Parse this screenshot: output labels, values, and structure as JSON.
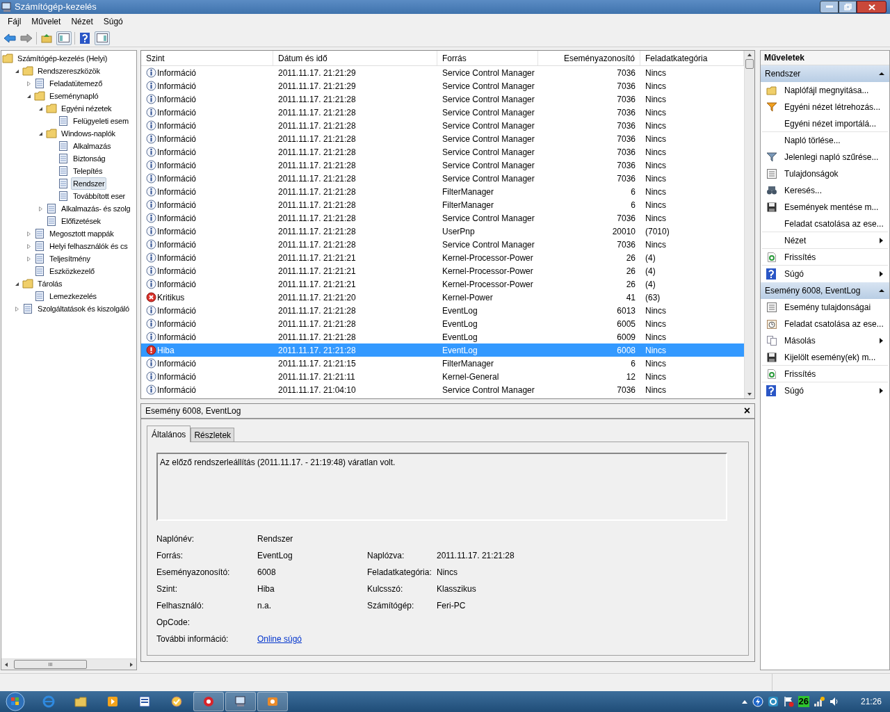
{
  "window": {
    "title": "Számítógép-kezelés"
  },
  "menu": [
    "Fájl",
    "Művelet",
    "Nézet",
    "Súgó"
  ],
  "tree": [
    {
      "label": "Számítógép-kezelés (Helyi)",
      "selected": false,
      "children": [
        {
          "label": "Rendszereszközök",
          "selected": false,
          "expanded": true,
          "children": [
            {
              "label": "Feladatütemező",
              "selected": false,
              "expanded": false
            },
            {
              "label": "Eseménynapló",
              "selected": false,
              "expanded": true,
              "children": [
                {
                  "label": "Egyéni nézetek",
                  "selected": false,
                  "expanded": true,
                  "children": [
                    {
                      "label": "Felügyeleti esem",
                      "selected": false
                    }
                  ]
                },
                {
                  "label": "Windows-naplók",
                  "selected": false,
                  "expanded": true,
                  "children": [
                    {
                      "label": "Alkalmazás",
                      "selected": false
                    },
                    {
                      "label": "Biztonság",
                      "selected": false
                    },
                    {
                      "label": "Telepítés",
                      "selected": false
                    },
                    {
                      "label": "Rendszer",
                      "selected": true
                    },
                    {
                      "label": "Továbbított eser",
                      "selected": false
                    }
                  ]
                },
                {
                  "label": "Alkalmazás- és szolg",
                  "selected": false,
                  "expanded": false
                },
                {
                  "label": "Előfizetések",
                  "selected": false
                }
              ]
            },
            {
              "label": "Megosztott mappák",
              "selected": false,
              "expanded": false
            },
            {
              "label": "Helyi felhasználók és cs",
              "selected": false,
              "expanded": false
            },
            {
              "label": "Teljesítmény",
              "selected": false,
              "expanded": false
            },
            {
              "label": "Eszközkezelő",
              "selected": false
            }
          ]
        },
        {
          "label": "Tárolás",
          "selected": false,
          "expanded": true,
          "children": [
            {
              "label": "Lemezkezelés",
              "selected": false
            }
          ]
        },
        {
          "label": "Szolgáltatások és kiszolgáló",
          "selected": false,
          "expanded": false
        }
      ]
    }
  ],
  "table": {
    "columns": [
      "Szint",
      "Dátum és idő",
      "Forrás",
      "Eseményazonosító",
      "Feladatkategória"
    ],
    "rows": [
      {
        "kind": "info",
        "level_text": "Információ",
        "date": "2011.11.17. 21:21:29",
        "source": "Service Control Manager",
        "id": "7036",
        "category": "Nincs",
        "selected": false
      },
      {
        "kind": "info",
        "level_text": "Információ",
        "date": "2011.11.17. 21:21:29",
        "source": "Service Control Manager",
        "id": "7036",
        "category": "Nincs",
        "selected": false
      },
      {
        "kind": "info",
        "level_text": "Információ",
        "date": "2011.11.17. 21:21:28",
        "source": "Service Control Manager",
        "id": "7036",
        "category": "Nincs",
        "selected": false
      },
      {
        "kind": "info",
        "level_text": "Információ",
        "date": "2011.11.17. 21:21:28",
        "source": "Service Control Manager",
        "id": "7036",
        "category": "Nincs",
        "selected": false
      },
      {
        "kind": "info",
        "level_text": "Információ",
        "date": "2011.11.17. 21:21:28",
        "source": "Service Control Manager",
        "id": "7036",
        "category": "Nincs",
        "selected": false
      },
      {
        "kind": "info",
        "level_text": "Információ",
        "date": "2011.11.17. 21:21:28",
        "source": "Service Control Manager",
        "id": "7036",
        "category": "Nincs",
        "selected": false
      },
      {
        "kind": "info",
        "level_text": "Információ",
        "date": "2011.11.17. 21:21:28",
        "source": "Service Control Manager",
        "id": "7036",
        "category": "Nincs",
        "selected": false
      },
      {
        "kind": "info",
        "level_text": "Információ",
        "date": "2011.11.17. 21:21:28",
        "source": "Service Control Manager",
        "id": "7036",
        "category": "Nincs",
        "selected": false
      },
      {
        "kind": "info",
        "level_text": "Információ",
        "date": "2011.11.17. 21:21:28",
        "source": "Service Control Manager",
        "id": "7036",
        "category": "Nincs",
        "selected": false
      },
      {
        "kind": "info",
        "level_text": "Információ",
        "date": "2011.11.17. 21:21:28",
        "source": "FilterManager",
        "id": "6",
        "category": "Nincs",
        "selected": false
      },
      {
        "kind": "info",
        "level_text": "Információ",
        "date": "2011.11.17. 21:21:28",
        "source": "FilterManager",
        "id": "6",
        "category": "Nincs",
        "selected": false
      },
      {
        "kind": "info",
        "level_text": "Információ",
        "date": "2011.11.17. 21:21:28",
        "source": "Service Control Manager",
        "id": "7036",
        "category": "Nincs",
        "selected": false
      },
      {
        "kind": "info",
        "level_text": "Információ",
        "date": "2011.11.17. 21:21:28",
        "source": "UserPnp",
        "id": "20010",
        "category": "(7010)",
        "selected": false
      },
      {
        "kind": "info",
        "level_text": "Információ",
        "date": "2011.11.17. 21:21:28",
        "source": "Service Control Manager",
        "id": "7036",
        "category": "Nincs",
        "selected": false
      },
      {
        "kind": "info",
        "level_text": "Információ",
        "date": "2011.11.17. 21:21:21",
        "source": "Kernel-Processor-Power",
        "id": "26",
        "category": "(4)",
        "selected": false
      },
      {
        "kind": "info",
        "level_text": "Információ",
        "date": "2011.11.17. 21:21:21",
        "source": "Kernel-Processor-Power",
        "id": "26",
        "category": "(4)",
        "selected": false
      },
      {
        "kind": "info",
        "level_text": "Információ",
        "date": "2011.11.17. 21:21:21",
        "source": "Kernel-Processor-Power",
        "id": "26",
        "category": "(4)",
        "selected": false
      },
      {
        "kind": "critical",
        "level_text": "Kritikus",
        "date": "2011.11.17. 21:21:20",
        "source": "Kernel-Power",
        "id": "41",
        "category": "(63)",
        "selected": false
      },
      {
        "kind": "info",
        "level_text": "Információ",
        "date": "2011.11.17. 21:21:28",
        "source": "EventLog",
        "id": "6013",
        "category": "Nincs",
        "selected": false
      },
      {
        "kind": "info",
        "level_text": "Információ",
        "date": "2011.11.17. 21:21:28",
        "source": "EventLog",
        "id": "6005",
        "category": "Nincs",
        "selected": false
      },
      {
        "kind": "info",
        "level_text": "Információ",
        "date": "2011.11.17. 21:21:28",
        "source": "EventLog",
        "id": "6009",
        "category": "Nincs",
        "selected": false
      },
      {
        "kind": "error",
        "level_text": "Hiba",
        "date": "2011.11.17. 21:21:28",
        "source": "EventLog",
        "id": "6008",
        "category": "Nincs",
        "selected": true
      },
      {
        "kind": "info",
        "level_text": "Információ",
        "date": "2011.11.17. 21:21:15",
        "source": "FilterManager",
        "id": "6",
        "category": "Nincs",
        "selected": false
      },
      {
        "kind": "info",
        "level_text": "Információ",
        "date": "2011.11.17. 21:21:11",
        "source": "Kernel-General",
        "id": "12",
        "category": "Nincs",
        "selected": false
      },
      {
        "kind": "info",
        "level_text": "Információ",
        "date": "2011.11.17. 21:04:10",
        "source": "Service Control Manager",
        "id": "7036",
        "category": "Nincs",
        "selected": false
      }
    ]
  },
  "detail": {
    "title": "Esemény 6008, EventLog",
    "close": "×",
    "tabs": [
      {
        "label": "Általános",
        "selected": true
      },
      {
        "label": "Részletek",
        "selected": false
      }
    ],
    "message": "Az előző rendszerleállítás (2011.11.17. - 21:19:48) váratlan volt.",
    "fields_left": [
      {
        "label": "Naplónév:",
        "value": "Rendszer"
      },
      {
        "label": "Forrás:",
        "value": "EventLog"
      },
      {
        "label": "Eseményazonosító:",
        "value": "6008"
      },
      {
        "label": "Szint:",
        "value": "Hiba"
      },
      {
        "label": "Felhasználó:",
        "value": "n.a."
      },
      {
        "label": "OpCode:"
      },
      {
        "label": "További információ:",
        "value": "Online súgó",
        "kind": "link"
      }
    ],
    "fields_right": [
      {
        "label": "Naplózva:",
        "value": "2011.11.17. 21:21:28"
      },
      {
        "label": "Feladatkategória:",
        "value": "Nincs"
      },
      {
        "label": "Kulcsszó:",
        "value": "Klasszikus"
      },
      {
        "label": "Számítógép:",
        "value": "Feri-PC"
      }
    ]
  },
  "actions": {
    "title": "Műveletek",
    "sections": [
      {
        "title": "Rendszer",
        "expanded": true,
        "items": [
          {
            "label": "Naplófájl megnyitása...",
            "kind": "open",
            "submenu": false,
            "separator_after": false
          },
          {
            "label": "Egyéni nézet létrehozás...",
            "kind": "create",
            "submenu": false,
            "separator_after": false
          },
          {
            "label": "Egyéni nézet importálá...",
            "kind": "import",
            "submenu": false,
            "separator_after": true
          },
          {
            "label": "Napló törlése...",
            "kind": "clear",
            "submenu": false,
            "separator_after": false
          },
          {
            "label": "Jelenlegi napló szűrése...",
            "kind": "filter",
            "submenu": false,
            "separator_after": false
          },
          {
            "label": "Tulajdonságok",
            "kind": "properties",
            "submenu": false,
            "separator_after": false
          },
          {
            "label": "Keresés...",
            "kind": "find",
            "submenu": false,
            "separator_after": false
          },
          {
            "label": "Események mentése m...",
            "kind": "save",
            "submenu": false,
            "separator_after": false
          },
          {
            "label": "Feladat csatolása az ese...",
            "kind": "attach",
            "submenu": false,
            "separator_after": true
          },
          {
            "label": "Nézet",
            "kind": "view",
            "submenu": true,
            "separator_after": true
          },
          {
            "label": "Frissítés",
            "kind": "refresh",
            "submenu": false,
            "separator_after": true
          },
          {
            "label": "Súgó",
            "kind": "help",
            "submenu": true,
            "separator_after": false
          }
        ]
      },
      {
        "title": "Esemény 6008, EventLog",
        "expanded": true,
        "items": [
          {
            "label": "Esemény tulajdonságai",
            "kind": "properties",
            "submenu": false,
            "separator_after": false
          },
          {
            "label": "Feladat csatolása az ese...",
            "kind": "schedule",
            "submenu": false,
            "separator_after": false
          },
          {
            "label": "Másolás",
            "kind": "copy",
            "submenu": true,
            "separator_after": false
          },
          {
            "label": "Kijelölt esemény(ek) m...",
            "kind": "save",
            "submenu": false,
            "separator_after": true
          },
          {
            "label": "Frissítés",
            "kind": "refresh",
            "submenu": false,
            "separator_after": true
          },
          {
            "label": "Súgó",
            "kind": "help",
            "submenu": true,
            "separator_after": false
          }
        ]
      }
    ]
  },
  "tree_scrollbar_grip": "III",
  "taskbar": {
    "apps": [
      {
        "selected": false
      },
      {
        "selected": false
      },
      {
        "selected": false
      },
      {
        "selected": false
      },
      {
        "selected": false
      },
      {
        "selected": true
      },
      {
        "selected": true
      },
      {
        "selected": true
      }
    ],
    "tray_badge": "26",
    "clock": "21:26"
  }
}
